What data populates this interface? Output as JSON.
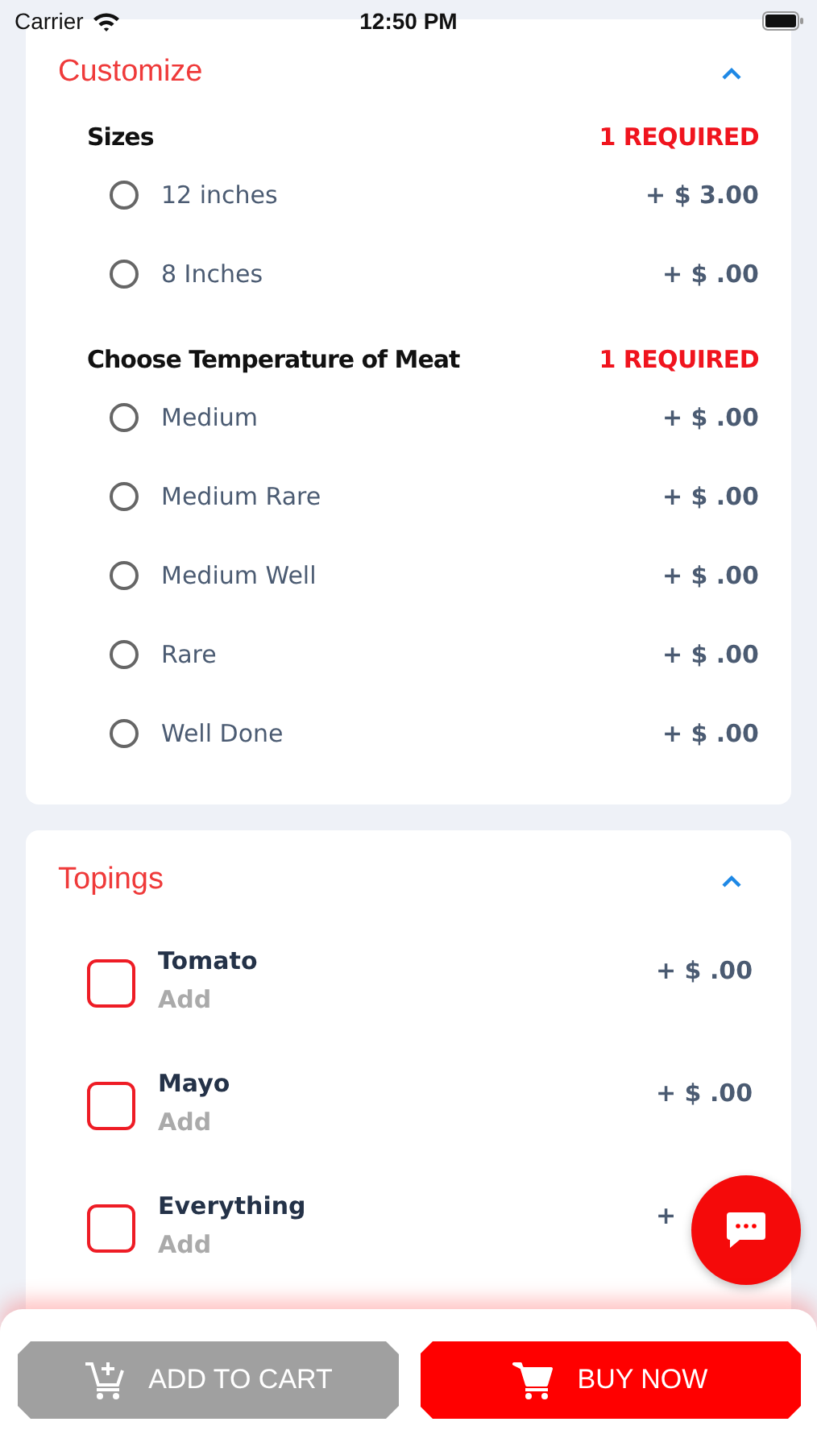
{
  "status_bar": {
    "carrier": "Carrier",
    "time": "12:50 PM"
  },
  "customize": {
    "title": "Customize",
    "expanded": true,
    "groups": [
      {
        "title": "Sizes",
        "requirement": "1 REQUIRED",
        "options": [
          {
            "label": "12 inches",
            "price": "+ $ 3.00",
            "selected": false
          },
          {
            "label": "8 Inches",
            "price": "+ $ .00",
            "selected": false
          }
        ]
      },
      {
        "title": "Choose Temperature of Meat",
        "requirement": "1 REQUIRED",
        "options": [
          {
            "label": "Medium",
            "price": "+ $ .00",
            "selected": false
          },
          {
            "label": "Medium Rare",
            "price": "+ $ .00",
            "selected": false
          },
          {
            "label": "Medium Well",
            "price": "+ $ .00",
            "selected": false
          },
          {
            "label": "Rare",
            "price": "+ $ .00",
            "selected": false
          },
          {
            "label": "Well Done",
            "price": "+ $ .00",
            "selected": false
          }
        ]
      }
    ]
  },
  "toppings": {
    "title": "Topings",
    "expanded": true,
    "items": [
      {
        "name": "Tomato",
        "action": "Add",
        "price": "+ $ .00",
        "checked": false
      },
      {
        "name": "Mayo",
        "action": "Add",
        "price": "+ $ .00",
        "checked": false
      },
      {
        "name": "Everything",
        "action": "Add",
        "price": "+",
        "checked": false
      }
    ]
  },
  "buttons": {
    "add_to_cart": "ADD TO CART",
    "buy_now": "BUY NOW"
  }
}
